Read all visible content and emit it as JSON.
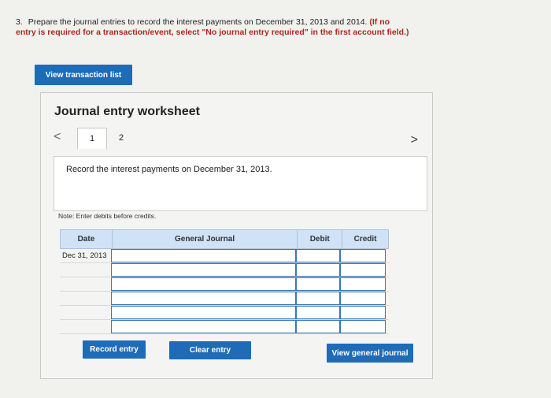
{
  "question": {
    "number": "3.",
    "text": "Prepare the journal entries to record the interest payments on December 31, 2013 and 2014.",
    "note": "(If no entry is required for a transaction/event, select \"No journal entry required\" in the first account field.)"
  },
  "view_transaction_list_label": "View transaction list",
  "worksheet": {
    "title": "Journal entry worksheet",
    "prev_icon": "<",
    "next_icon": ">",
    "tabs": [
      "1",
      "2"
    ],
    "instruction": "Record the interest payments on December 31, 2013.",
    "note": "Note: Enter debits before credits.",
    "columns": {
      "date": "Date",
      "general_journal": "General Journal",
      "debit": "Debit",
      "credit": "Credit"
    },
    "rows": [
      {
        "date": "Dec 31, 2013"
      },
      {
        "date": ""
      },
      {
        "date": ""
      },
      {
        "date": ""
      },
      {
        "date": ""
      },
      {
        "date": ""
      }
    ],
    "buttons": {
      "record": "Record entry",
      "clear": "Clear entry",
      "view_general_journal": "View general journal"
    }
  }
}
